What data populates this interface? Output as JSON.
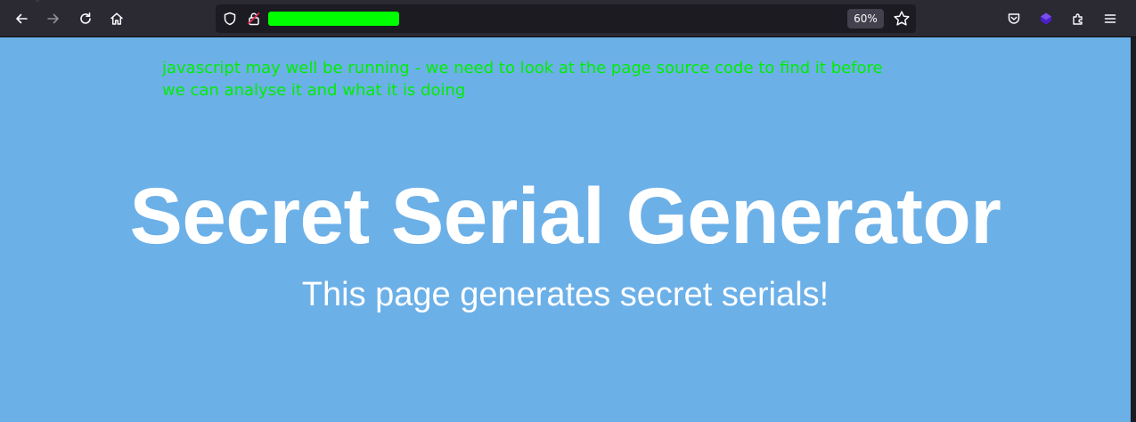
{
  "browser": {
    "zoom_level": "60%",
    "url_redacted_color": "#00ff00",
    "icons": {
      "back": "arrow-left-icon",
      "forward": "arrow-right-icon",
      "reload": "reload-icon",
      "home": "home-icon",
      "tracking_protection": "shield-icon",
      "insecure_connection": "lock-warning-icon",
      "bookmark": "star-icon",
      "pocket": "pocket-icon",
      "extension": "extension-purple-icon",
      "extensions_menu": "puzzle-icon",
      "app_menu": "hamburger-menu-icon"
    }
  },
  "page": {
    "background_color": "#6cb0e8",
    "annotation": "javascript may well be running - we need to look at the page source code to find it before we can analyse it and what it is doing",
    "annotation_color": "#00ee00",
    "title": "Secret Serial Generator",
    "subtitle": "This page generates secret serials!"
  }
}
